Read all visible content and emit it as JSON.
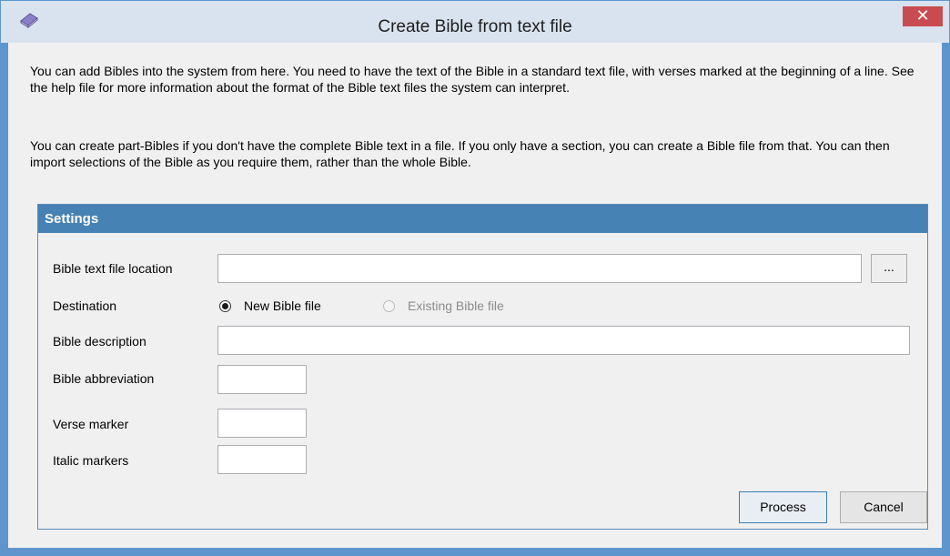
{
  "window": {
    "title": "Create Bible from text file",
    "close_glyph": "✕",
    "icon": "bible-book-icon"
  },
  "intro": {
    "paragraph1": "You can add Bibles into the system from here. You need to have the text of the Bible in a standard text file, with verses marked at the beginning of a line. See the help file for more information about the format of the Bible text files the system can interpret.",
    "paragraph2": "You can create part-Bibles if you don't have the complete Bible text in a file.  If you only have a section, you can create a Bible file from that. You can then import selections of the Bible as you require them, rather than the whole Bible."
  },
  "settings": {
    "header": "Settings",
    "file_location_label": "Bible text file location",
    "file_location_value": "",
    "browse_label": "...",
    "destination_label": "Destination",
    "destination_options": [
      {
        "label": "New Bible file",
        "selected": true,
        "enabled": true
      },
      {
        "label": "Existing Bible file",
        "selected": false,
        "enabled": false
      }
    ],
    "description_label": "Bible description",
    "description_value": "",
    "abbreviation_label": "Bible abbreviation",
    "abbreviation_value": "",
    "verse_marker_label": "Verse marker",
    "verse_marker_value": "",
    "italic_markers_label": "Italic markers",
    "italic_markers_value": ""
  },
  "buttons": {
    "process": "Process",
    "cancel": "Cancel"
  },
  "colors": {
    "frame": "#5d95cc",
    "settings_header": "#4682b4",
    "close_button": "#c74b50"
  }
}
